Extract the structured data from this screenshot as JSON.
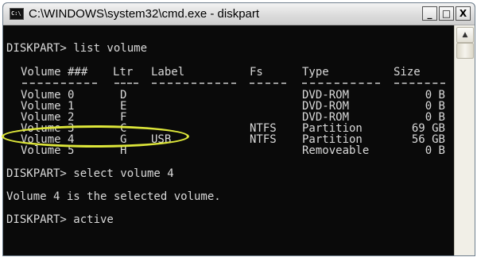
{
  "window": {
    "title": "C:\\WINDOWS\\system32\\cmd.exe - diskpart",
    "icon": "cmd-icon",
    "buttons": {
      "minimize": "_",
      "maximize": "□",
      "close": "X"
    }
  },
  "console": {
    "prompt1": "DISKPART> list volume",
    "headers": [
      "Volume ###",
      "Ltr",
      "Label",
      "Fs",
      "Type",
      "Size"
    ],
    "rows": [
      [
        "Volume 0",
        "D",
        "",
        "",
        "DVD-ROM",
        "0 B"
      ],
      [
        "Volume 1",
        "E",
        "",
        "",
        "DVD-ROM",
        "0 B"
      ],
      [
        "Volume 2",
        "F",
        "",
        "",
        "DVD-ROM",
        "0 B"
      ],
      [
        "Volume 3",
        "C",
        "",
        "NTFS",
        "Partition",
        "69 GB"
      ],
      [
        "Volume 4",
        "G",
        "USB",
        "NTFS",
        "Partition",
        "56 GB"
      ],
      [
        "Volume 5",
        "H",
        "",
        "",
        "Removeable",
        "0 B"
      ]
    ],
    "prompt2": "DISKPART> select volume 4",
    "message": "Volume 4 is the selected volume.",
    "prompt3": "DISKPART> active"
  },
  "colors": {
    "console_bg": "#0a0a0a",
    "console_text": "#d9d9d9",
    "highlight": "#dde63a"
  }
}
